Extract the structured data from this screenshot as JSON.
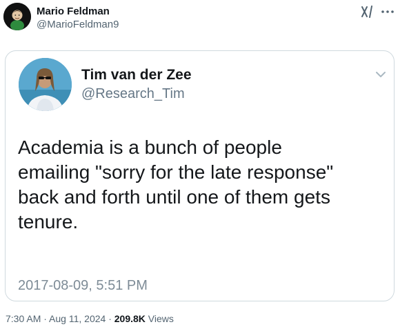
{
  "author": {
    "name": "Mario Feldman",
    "handle": "@MarioFeldman9"
  },
  "quoted_tweet": {
    "name": "Tim van der Zee",
    "handle": "@Research_Tim",
    "text": "Academia is a bunch of people\nemailing \"sorry for the late response\"\nback and forth until one of them gets\ntenure.",
    "timestamp": "2017-08-09, 5:51 PM"
  },
  "meta": {
    "time": "7:30 AM",
    "separator": " · ",
    "date": "Aug 11, 2024",
    "views_count": "209.8K",
    "views_label": " Views"
  },
  "icons": {
    "grok": "grok-icon",
    "more": "more-icon",
    "chevron": "chevron-down-icon"
  },
  "colors": {
    "text": "#0f1419",
    "secondary": "#536471",
    "border": "#cfd9de"
  }
}
